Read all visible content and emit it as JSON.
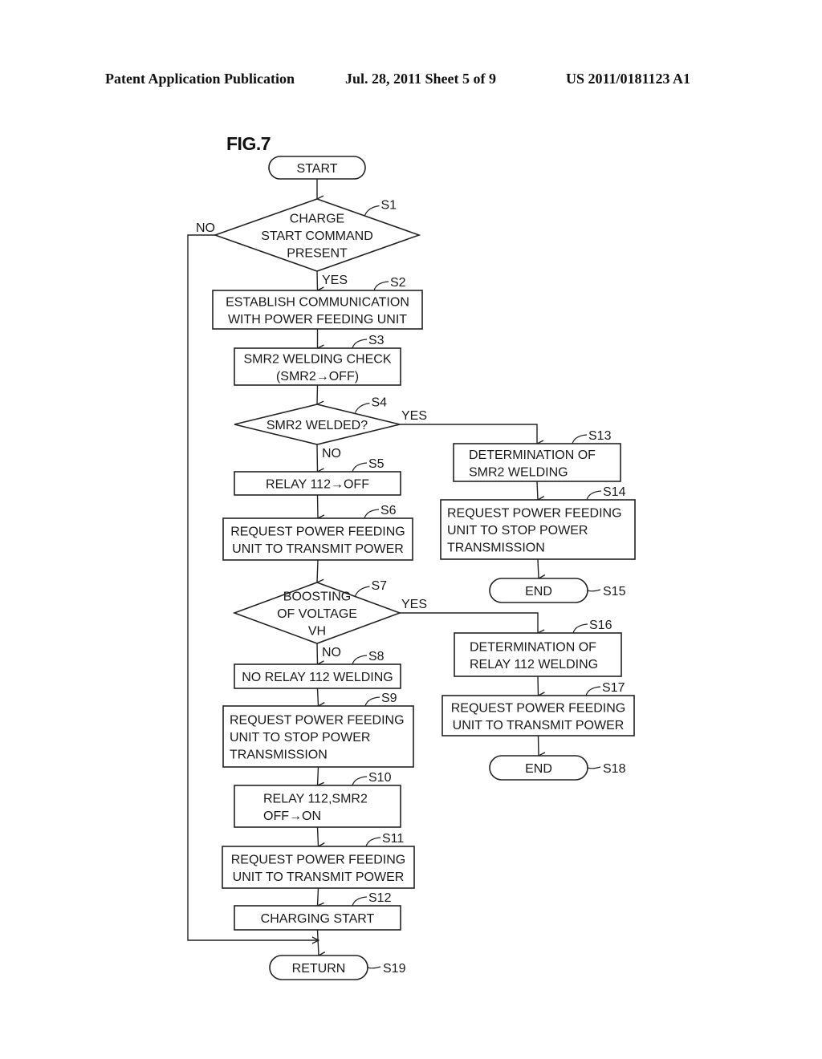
{
  "header": {
    "left": "Patent Application Publication",
    "middle": "Jul. 28, 2011   Sheet 5 of 9",
    "right": "US 2011/0181123 A1"
  },
  "figure": {
    "label": "FIG.7",
    "nodes": [
      {
        "id": "start",
        "type": "terminal",
        "lines": [
          "START"
        ],
        "step": ""
      },
      {
        "id": "s1",
        "type": "decision",
        "lines": [
          "CHARGE",
          "START COMMAND",
          "PRESENT"
        ],
        "step": "S1"
      },
      {
        "id": "s2",
        "type": "process",
        "lines": [
          "ESTABLISH COMMUNICATION",
          "WITH POWER FEEDING UNIT"
        ],
        "step": "S2"
      },
      {
        "id": "s3",
        "type": "process",
        "lines": [
          "SMR2 WELDING CHECK",
          "(SMR2→OFF)"
        ],
        "step": "S3"
      },
      {
        "id": "s4",
        "type": "decision",
        "lines": [
          "SMR2 WELDED?"
        ],
        "step": "S4"
      },
      {
        "id": "s5",
        "type": "process",
        "lines": [
          "RELAY 112→OFF"
        ],
        "step": "S5"
      },
      {
        "id": "s6",
        "type": "process",
        "lines": [
          "REQUEST POWER FEEDING",
          "UNIT TO TRANSMIT POWER"
        ],
        "step": "S6"
      },
      {
        "id": "s7",
        "type": "decision",
        "lines": [
          "BOOSTING",
          "OF VOLTAGE",
          "VH"
        ],
        "step": "S7"
      },
      {
        "id": "s8",
        "type": "process",
        "lines": [
          "NO RELAY 112 WELDING"
        ],
        "step": "S8"
      },
      {
        "id": "s9",
        "type": "process",
        "lines": [
          "REQUEST POWER FEEDING",
          "UNIT TO STOP POWER",
          "TRANSMISSION"
        ],
        "step": "S9"
      },
      {
        "id": "s10",
        "type": "process",
        "lines": [
          "RELAY 112,SMR2",
          "OFF→ON"
        ],
        "step": "S10"
      },
      {
        "id": "s11",
        "type": "process",
        "lines": [
          "REQUEST POWER FEEDING",
          "UNIT TO TRANSMIT POWER"
        ],
        "step": "S11"
      },
      {
        "id": "s12",
        "type": "process",
        "lines": [
          "CHARGING START"
        ],
        "step": "S12"
      },
      {
        "id": "s13",
        "type": "process",
        "lines": [
          "DETERMINATION OF",
          "SMR2 WELDING"
        ],
        "step": "S13"
      },
      {
        "id": "s14",
        "type": "process",
        "lines": [
          "REQUEST POWER FEEDING",
          "UNIT TO STOP POWER",
          "TRANSMISSION"
        ],
        "step": "S14"
      },
      {
        "id": "s15",
        "type": "terminal",
        "lines": [
          "END"
        ],
        "step": "S15"
      },
      {
        "id": "s16",
        "type": "process",
        "lines": [
          "DETERMINATION OF",
          "RELAY 112 WELDING"
        ],
        "step": "S16"
      },
      {
        "id": "s17",
        "type": "process",
        "lines": [
          "REQUEST POWER FEEDING",
          "UNIT TO TRANSMIT POWER"
        ],
        "step": "S17"
      },
      {
        "id": "s18",
        "type": "terminal",
        "lines": [
          "END"
        ],
        "step": "S18"
      },
      {
        "id": "s19",
        "type": "terminal",
        "lines": [
          "RETURN"
        ],
        "step": "S19"
      }
    ],
    "edges": [
      {
        "from": "start",
        "to": "s1",
        "label": ""
      },
      {
        "from": "s1",
        "to": "s2",
        "label": "YES"
      },
      {
        "from": "s1",
        "to": "s19",
        "label": "NO"
      },
      {
        "from": "s2",
        "to": "s3",
        "label": ""
      },
      {
        "from": "s3",
        "to": "s4",
        "label": ""
      },
      {
        "from": "s4",
        "to": "s5",
        "label": "NO"
      },
      {
        "from": "s4",
        "to": "s13",
        "label": "YES"
      },
      {
        "from": "s5",
        "to": "s6",
        "label": ""
      },
      {
        "from": "s6",
        "to": "s7",
        "label": ""
      },
      {
        "from": "s7",
        "to": "s8",
        "label": "NO"
      },
      {
        "from": "s7",
        "to": "s16",
        "label": "YES"
      },
      {
        "from": "s8",
        "to": "s9",
        "label": ""
      },
      {
        "from": "s9",
        "to": "s10",
        "label": ""
      },
      {
        "from": "s10",
        "to": "s11",
        "label": ""
      },
      {
        "from": "s11",
        "to": "s12",
        "label": ""
      },
      {
        "from": "s12",
        "to": "s19",
        "label": ""
      },
      {
        "from": "s13",
        "to": "s14",
        "label": ""
      },
      {
        "from": "s14",
        "to": "s15",
        "label": ""
      },
      {
        "from": "s16",
        "to": "s17",
        "label": ""
      },
      {
        "from": "s17",
        "to": "s18",
        "label": ""
      }
    ]
  }
}
